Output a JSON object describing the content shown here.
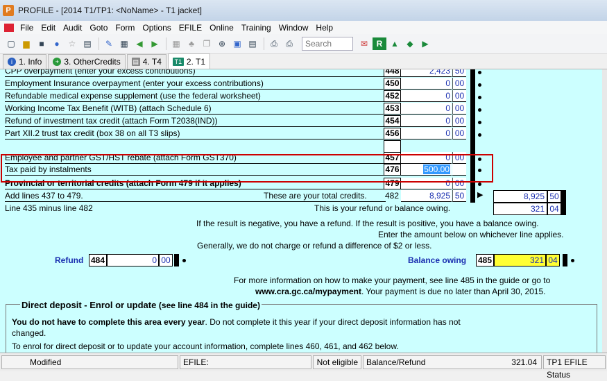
{
  "window": {
    "title": "PROFILE - [2014 T1/TP1: <NoName> - T1 jacket]",
    "icon": "profile-app-icon"
  },
  "menu": [
    "File",
    "Edit",
    "Audit",
    "Goto",
    "Form",
    "Options",
    "EFILE",
    "Online",
    "Training",
    "Window",
    "Help"
  ],
  "toolbar": {
    "search_placeholder": "Search",
    "icons": [
      "new-doc-icon",
      "open-folder-icon",
      "save-icon",
      "info-icon",
      "star-icon",
      "forms-icon",
      "edit-icon",
      "calculator-icon",
      "back-arrow-icon",
      "forward-arrow-icon",
      "grid-icon",
      "tree-icon",
      "copy-icon",
      "zoom-icon",
      "table-icon",
      "sheet-icon",
      "print-icon",
      "printer2-icon",
      "mail-icon",
      "review-icon",
      "bell-icon",
      "chat-icon",
      "help-icon"
    ]
  },
  "tabs": [
    {
      "label": "1. Info",
      "icon": "info-icon"
    },
    {
      "label": "3. OtherCredits",
      "icon": "plus-icon"
    },
    {
      "label": "4. T4",
      "icon": "t4-icon"
    },
    {
      "label": "2. T1",
      "icon": "t1-icon",
      "active": true
    }
  ],
  "form": {
    "rows": [
      {
        "label": "CPP overpayment (enter your excess contributions)",
        "line": "448",
        "amount": "2,423",
        "cents": "50"
      },
      {
        "label": "Employment Insurance overpayment (enter your excess contributions)",
        "line": "450",
        "amount": "0",
        "cents": "00"
      },
      {
        "label": "Refundable medical expense supplement (use the federal worksheet)",
        "line": "452",
        "amount": "0",
        "cents": "00"
      },
      {
        "label": "Working Income Tax Benefit (WITB) (attach Schedule 6)",
        "line": "453",
        "amount": "0",
        "cents": "00"
      },
      {
        "label": "Refund of investment tax credit (attach Form T2038(IND))",
        "line": "454",
        "amount": "0",
        "cents": "00"
      },
      {
        "label": "Part XII.2 trust tax credit (box 38 on all T3 slips)",
        "line": "456",
        "amount": "0",
        "cents": "00"
      },
      {
        "label": "Employee and partner GST/HST rebate (attach Form GST370)",
        "line": "457",
        "amount": "0",
        "cents": "00"
      },
      {
        "label": "Tax paid by instalments",
        "line": "476",
        "amount": "500.00",
        "cents": ""
      },
      {
        "label": "Provincial or territorial credits (attach Form 479 if it applies)",
        "line": "479",
        "amount": "0",
        "cents": "00"
      }
    ],
    "add_lines": "Add lines 437 to 479.",
    "total_credits_text": "These are your total credits.",
    "line_482": "482",
    "total_amount": "8,925",
    "total_cents": "50",
    "right_total_amount": "8,925",
    "right_total_cents": "50",
    "line435_text": "Line 435 minus line 482",
    "refund_balance_text": "This is your refund or balance owing.",
    "refund_balance_amount": "321",
    "refund_balance_cents": "04",
    "info1": "If the result is negative, you have a refund. If the result is positive, you have a balance owing.",
    "info2": "Enter the amount below on whichever line applies.",
    "info3": "Generally, we do not charge or refund a difference of $2 or less.",
    "refund_label": "Refund",
    "refund_line": "484",
    "refund_amount": "0",
    "refund_cents": "00",
    "balance_label": "Balance owing",
    "balance_line": "485",
    "balance_amount": "321",
    "balance_cents": "04",
    "payment_info1": "For more information on how to make your payment, see line 485 in the guide or go to",
    "payment_url": "www.cra.gc.ca/mypayment",
    "payment_info2": ". Your payment is due no later than April 30, 2015.",
    "dd_title": "Direct deposit - Enrol or update",
    "dd_sub": "(see line 484 in the guide)",
    "dd_bold": "You do not have to complete this area every year",
    "dd_rest": ". Do not complete it this year if your direct deposit information has not",
    "dd_rest2": "changed.",
    "dd_enrol": "To enrol for direct deposit or to update your account information, complete lines 460, 461, and 462 below."
  },
  "status": {
    "modified": "Modified",
    "efile_label": "EFILE:",
    "eligibility": "Not eligible",
    "balance_refund": "Balance/Refund",
    "amount": "321.04",
    "tp1": "TP1 EFILE Status"
  },
  "colors": {
    "form_bg": "#ccffff",
    "highlight_border": "#cc0000",
    "balance_bg": "#ffff33",
    "selected_field": "#3399ff"
  }
}
